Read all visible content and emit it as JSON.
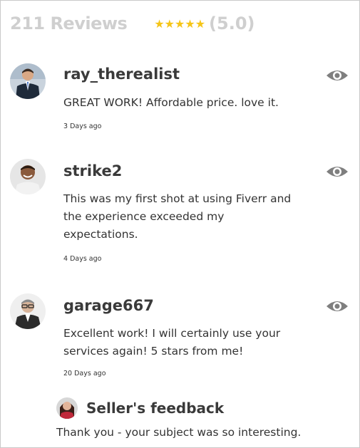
{
  "header": {
    "review_count": "211 Reviews",
    "stars": "★★★★★",
    "rating": "(5.0)",
    "star_color": "#f5c518"
  },
  "reviews": [
    {
      "username": "ray_therealist",
      "text": "GREAT WORK! Affordable price. love it.",
      "date": "3 Days ago",
      "avatar": "avatar-suit-man",
      "action_icon": "eye-icon"
    },
    {
      "username": "strike2",
      "text": "This was my first shot at using Fiverr and the experience exceeded my expectations.",
      "date": "4 Days ago",
      "avatar": "avatar-smiling-man",
      "action_icon": "eye-icon"
    },
    {
      "username": "garage667",
      "text": "Excellent work! I will certainly use your services again! 5 stars from me!",
      "date": "20 Days ago",
      "avatar": "avatar-glasses-man",
      "action_icon": "eye-icon"
    }
  ],
  "seller_feedback": {
    "title": "Seller's feedback",
    "text": "Thank you - your subject was so interesting.",
    "avatar": "avatar-woman"
  }
}
